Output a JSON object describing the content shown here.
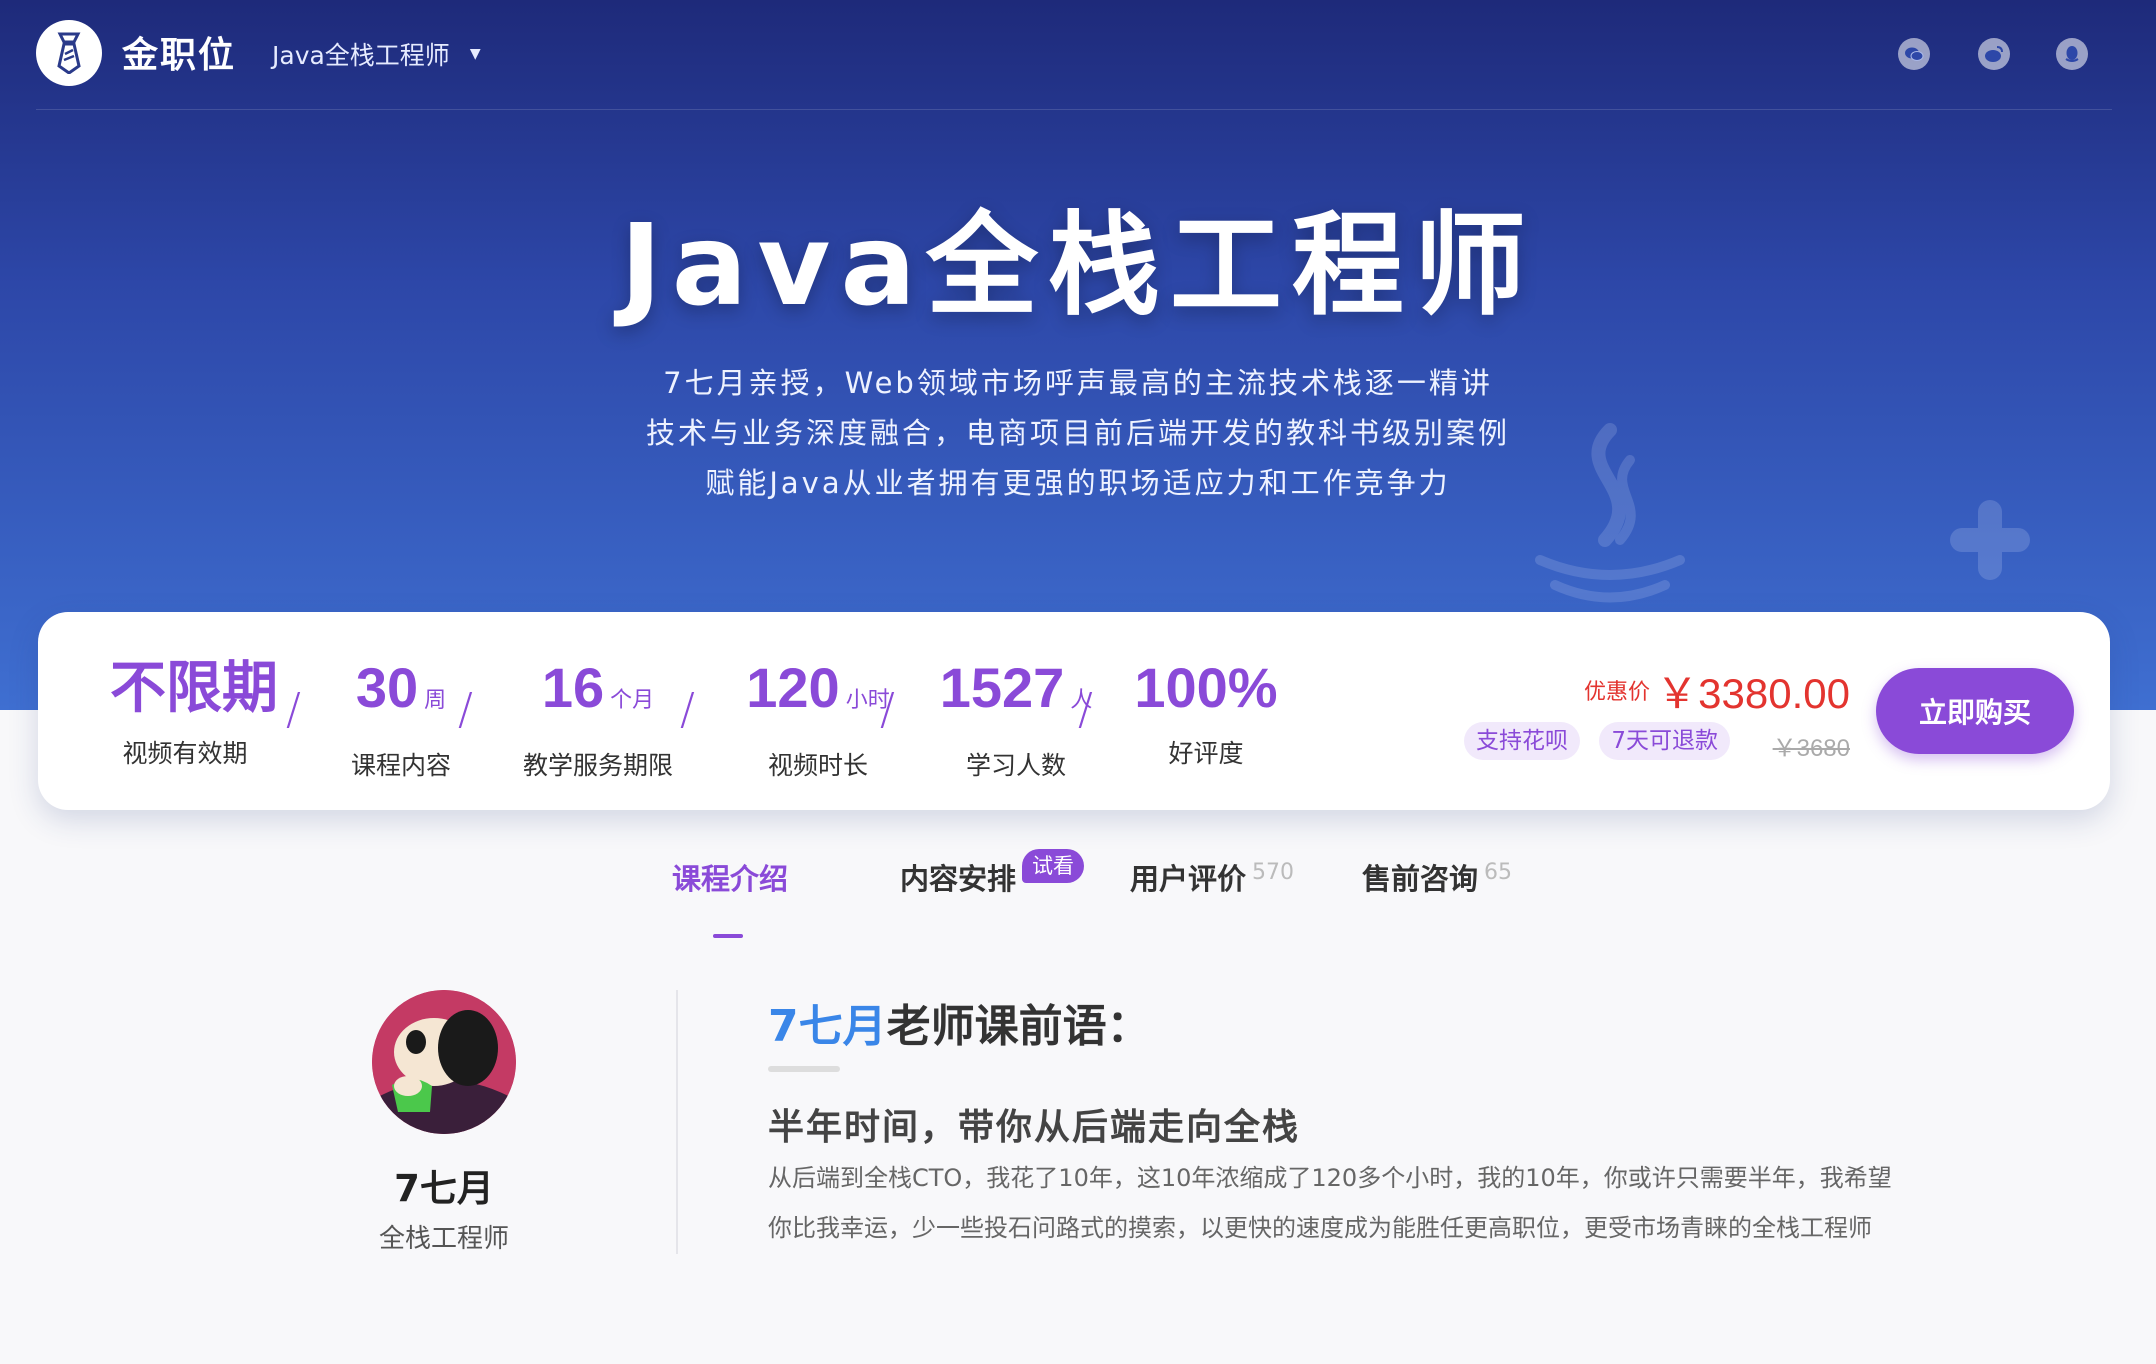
{
  "nav": {
    "brand": "金职位",
    "course_selector": "Java全栈工程师"
  },
  "hero": {
    "title": "Java全栈工程师",
    "lines": [
      "7七月亲授，Web领域市场呼声最高的主流技术栈逐一精讲",
      "技术与业务深度融合，电商项目前后端开发的教科书级别案例",
      "赋能Java从业者拥有更强的职场适应力和工作竞争力"
    ]
  },
  "stats": [
    {
      "value": "不限期",
      "unit": "",
      "label": "视频有效期"
    },
    {
      "value": "30",
      "unit": "周",
      "label": "课程内容"
    },
    {
      "value": "16",
      "unit": "个月",
      "label": "教学服务期限"
    },
    {
      "value": "120",
      "unit": "小时",
      "label": "视频时长"
    },
    {
      "value": "1527",
      "unit": "人",
      "label": "学习人数"
    },
    {
      "value": "100%",
      "unit": "",
      "label": "好评度"
    }
  ],
  "price": {
    "label": "优惠价",
    "value": "￥3380.00",
    "original": "￥3680",
    "badges": [
      "支持花呗",
      "7天可退款"
    ]
  },
  "buy_button": "立即购买",
  "tabs": [
    {
      "label": "课程介绍",
      "count": ""
    },
    {
      "label": "内容安排",
      "count": ""
    },
    {
      "label": "用户评价",
      "count": "570"
    },
    {
      "label": "售前咨询",
      "count": "65"
    }
  ],
  "trial_badge": "试看",
  "teacher": {
    "name": "7七月",
    "title": "全栈工程师"
  },
  "preface": {
    "highlight": "7七月",
    "heading_suffix": "老师课前语：",
    "slogan": "半年时间，带你从后端走向全栈",
    "paragraphs": [
      "从后端到全栈CTO，我花了10年，这10年浓缩成了120多个小时，我的10年，你或许只需要半年，我希望",
      "你比我幸运，少一些投石问路式的摸索，以更快的速度成为能胜任更高职位，更受市场青睐的全栈工程师"
    ]
  },
  "colors": {
    "accent": "#8a4ad8",
    "price": "#e3342f",
    "highlight": "#3a86e8",
    "hero_top": "#1e2a7a",
    "hero_bottom": "#3f6fd1"
  }
}
